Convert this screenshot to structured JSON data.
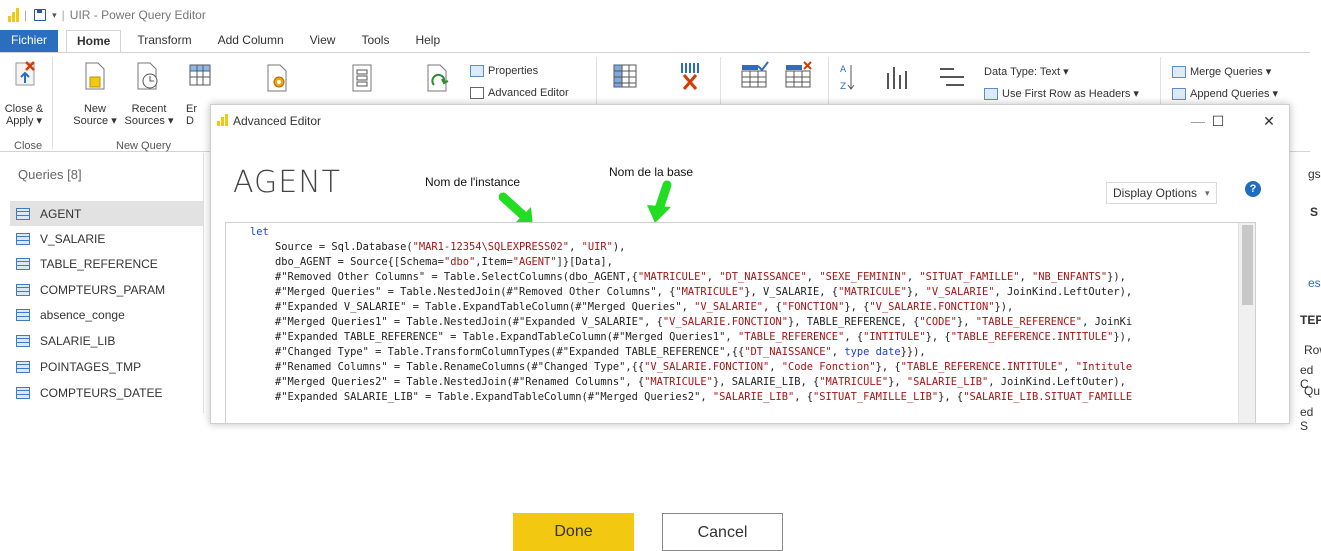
{
  "app": {
    "window_title": "UIR - Power Query Editor",
    "brand_color": "#f2c811",
    "accent_color": "#2b6ebf"
  },
  "tabs": [
    "Fichier",
    "Home",
    "Transform",
    "Add Column",
    "View",
    "Tools",
    "Help"
  ],
  "ribbon": {
    "close_apply": [
      "Close &",
      "Apply ▾"
    ],
    "new_source": [
      "New",
      "Source ▾"
    ],
    "recent_sources": [
      "Recent",
      "Sources ▾"
    ],
    "enter_data_partial": [
      "Er",
      "D"
    ],
    "group_close": "Close",
    "group_new_query": "New Query",
    "properties": "Properties",
    "advanced_editor": "Advanced Editor",
    "data_type": "Data Type: Text ▾",
    "use_first_row": "Use First Row as Headers ▾",
    "merge_queries": "Merge Queries ▾",
    "append_queries": "Append Queries ▾"
  },
  "queries_pane": {
    "header": "Queries [8]",
    "items": [
      "AGENT",
      "V_SALARIE",
      "TABLE_REFERENCE",
      "COMPTEURS_PARAM",
      "absence_conge",
      "SALARIE_LIB",
      "POINTAGES_TMP",
      "COMPTEURS_DATEE"
    ]
  },
  "right_pane_fragments": [
    "gs",
    "S",
    "es",
    "TEPS",
    "Row",
    "ed C",
    "Qu",
    "ed S"
  ],
  "dialog": {
    "title": "Advanced Editor",
    "query_name": "AGENT",
    "display_options": "Display Options",
    "help_icon": "?",
    "minimize": "—",
    "maximize": "☐",
    "close": "✕"
  },
  "annotations": {
    "instance": "Nom de l'instance",
    "database": "Nom de la base",
    "arrow_color": "#22dd22"
  },
  "code_lines": [
    [
      [
        "kw",
        "let"
      ]
    ],
    [
      [
        "t",
        "    Source = Sql.Database("
      ],
      [
        "s",
        "\"MAR1-12354\\SQLEXPRESS02\""
      ],
      [
        "t",
        ", "
      ],
      [
        "s",
        "\"UIR\""
      ],
      [
        "t",
        "),"
      ]
    ],
    [
      [
        "t",
        "    dbo_AGENT = Source{[Schema="
      ],
      [
        "s",
        "\"dbo\""
      ],
      [
        "t",
        ",Item="
      ],
      [
        "s",
        "\"AGENT\""
      ],
      [
        "t",
        "]}[Data],"
      ]
    ],
    [
      [
        "t",
        "    #\"Removed Other Columns\" = Table.SelectColumns(dbo_AGENT,{"
      ],
      [
        "s",
        "\"MATRICULE\""
      ],
      [
        "t",
        ", "
      ],
      [
        "s",
        "\"DT_NAISSANCE\""
      ],
      [
        "t",
        ", "
      ],
      [
        "s",
        "\"SEXE_FEMININ\""
      ],
      [
        "t",
        ", "
      ],
      [
        "s",
        "\"SITUAT_FAMILLE\""
      ],
      [
        "t",
        ", "
      ],
      [
        "s",
        "\"NB_ENFANTS\""
      ],
      [
        "t",
        "}),"
      ]
    ],
    [
      [
        "t",
        "    #\"Merged Queries\" = Table.NestedJoin(#\"Removed Other Columns\", {"
      ],
      [
        "s",
        "\"MATRICULE\""
      ],
      [
        "t",
        "}, V_SALARIE, {"
      ],
      [
        "s",
        "\"MATRICULE\""
      ],
      [
        "t",
        "}, "
      ],
      [
        "s",
        "\"V_SALARIE\""
      ],
      [
        "t",
        ", JoinKind.LeftOuter),"
      ]
    ],
    [
      [
        "t",
        "    #\"Expanded V_SALARIE\" = Table.ExpandTableColumn(#\"Merged Queries\", "
      ],
      [
        "s",
        "\"V_SALARIE\""
      ],
      [
        "t",
        ", {"
      ],
      [
        "s",
        "\"FONCTION\""
      ],
      [
        "t",
        "}, {"
      ],
      [
        "s",
        "\"V_SALARIE.FONCTION\""
      ],
      [
        "t",
        "}),"
      ]
    ],
    [
      [
        "t",
        "    #\"Merged Queries1\" = Table.NestedJoin(#\"Expanded V_SALARIE\", {"
      ],
      [
        "s",
        "\"V_SALARIE.FONCTION\""
      ],
      [
        "t",
        "}, TABLE_REFERENCE, {"
      ],
      [
        "s",
        "\"CODE\""
      ],
      [
        "t",
        "}, "
      ],
      [
        "s",
        "\"TABLE_REFERENCE\""
      ],
      [
        "t",
        ", JoinKi"
      ]
    ],
    [
      [
        "t",
        "    #\"Expanded TABLE_REFERENCE\" = Table.ExpandTableColumn(#\"Merged Queries1\", "
      ],
      [
        "s",
        "\"TABLE_REFERENCE\""
      ],
      [
        "t",
        ", {"
      ],
      [
        "s",
        "\"INTITULE\""
      ],
      [
        "t",
        "}, {"
      ],
      [
        "s",
        "\"TABLE_REFERENCE.INTITULE\""
      ],
      [
        "t",
        "}),"
      ]
    ],
    [
      [
        "t",
        "    #\"Changed Type\" = Table.TransformColumnTypes(#\"Expanded TABLE_REFERENCE\",{{"
      ],
      [
        "s",
        "\"DT_NAISSANCE\""
      ],
      [
        "t",
        ", "
      ],
      [
        "kw",
        "type date"
      ],
      [
        "t",
        "}}),"
      ]
    ],
    [
      [
        "t",
        "    #\"Renamed Columns\" = Table.RenameColumns(#\"Changed Type\",{{"
      ],
      [
        "s",
        "\"V_SALARIE.FONCTION\""
      ],
      [
        "t",
        ", "
      ],
      [
        "s",
        "\"Code Fonction\""
      ],
      [
        "t",
        "}, {"
      ],
      [
        "s",
        "\"TABLE_REFERENCE.INTITULE\""
      ],
      [
        "t",
        ", "
      ],
      [
        "s",
        "\"Intitule"
      ]
    ],
    [
      [
        "t",
        "    #\"Merged Queries2\" = Table.NestedJoin(#\"Renamed Columns\", {"
      ],
      [
        "s",
        "\"MATRICULE\""
      ],
      [
        "t",
        "}, SALARIE_LIB, {"
      ],
      [
        "s",
        "\"MATRICULE\""
      ],
      [
        "t",
        "}, "
      ],
      [
        "s",
        "\"SALARIE_LIB\""
      ],
      [
        "t",
        ", JoinKind.LeftOuter),"
      ]
    ],
    [
      [
        "t",
        "    #\"Expanded SALARIE_LIB\" = Table.ExpandTableColumn(#\"Merged Queries2\", "
      ],
      [
        "s",
        "\"SALARIE_LIB\""
      ],
      [
        "t",
        ", {"
      ],
      [
        "s",
        "\"SITUAT_FAMILLE_LIB\""
      ],
      [
        "t",
        "}, {"
      ],
      [
        "s",
        "\"SALARIE_LIB.SITUAT_FAMILLE"
      ]
    ]
  ],
  "buttons": {
    "done": "Done",
    "cancel": "Cancel"
  }
}
